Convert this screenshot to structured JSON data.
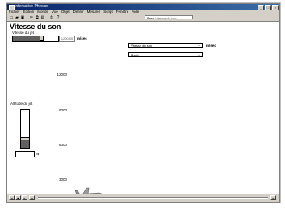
{
  "window": {
    "title": "Interactive Physics"
  },
  "menu": [
    "Fichier",
    "Édition",
    "Monde",
    "Vue",
    "Objet",
    "Définir",
    "Mesurer",
    "Script",
    "Fenêtre",
    "Aide"
  ],
  "toolbar": {
    "icons": [
      "new-icon",
      "open-icon",
      "save-icon",
      "cut-icon",
      "copy-icon",
      "paste-icon",
      "print-icon",
      "help-icon"
    ],
    "combo_label": "Base",
    "combo_hint": "Vitesse du son"
  },
  "main": {
    "heading": "Vitesse du son",
    "speed_label": "Vitesse du jet",
    "speed_value": "1200.00",
    "speed_fraction": 0.62,
    "speed_unit": "m/sec",
    "dropdown1": "Vitesse du son",
    "dropdown1_unit": "m/sec",
    "dropdown2": "Mach",
    "altitude_label": "Altitude du jet",
    "altitude_fraction": 0.25,
    "altitude_value": "",
    "altitude_unit": "m",
    "axis_ticks": [
      "12000",
      "9000",
      "6000",
      "3000"
    ]
  },
  "colors": {
    "titlebar": "#0a246a",
    "chrome": "#d4d0c8",
    "fill": "#606060"
  }
}
